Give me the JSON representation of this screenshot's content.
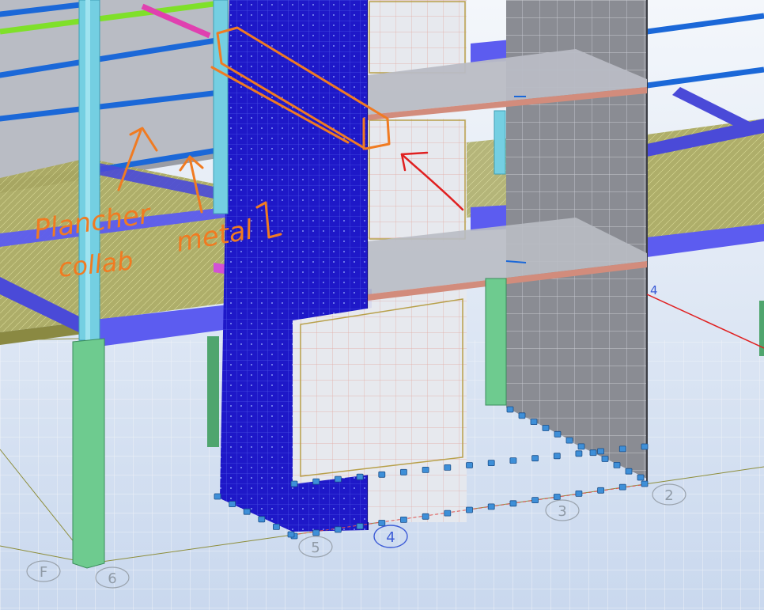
{
  "colors": {
    "background_top": "#f4f7fb",
    "background_bottom": "#c9d8ee",
    "blue_wall": "#1e18c8",
    "gray_wall": "#8a8c93",
    "slab_gray": "#b9bcc4",
    "beam_purple": "#5c5cf0",
    "column_cyan": "#74cfe2",
    "column_green": "#6ecb8f",
    "annotation_orange": "#f07b22",
    "annotation_red": "#e02020",
    "grid_label": "#8f9aa6",
    "grid_label_selected": "#3c5bd6"
  },
  "annotations": {
    "handwritten_line1": "Plancher",
    "handwritten_line2": "collab",
    "handwritten_metal": "metal"
  },
  "grid_labels": [
    {
      "id": "2",
      "text": "2",
      "selected": false
    },
    {
      "id": "3",
      "text": "3",
      "selected": false
    },
    {
      "id": "4",
      "text": "4",
      "selected": true
    },
    {
      "id": "5",
      "text": "5",
      "selected": false
    },
    {
      "id": "6",
      "text": "6",
      "selected": false
    },
    {
      "id": "F",
      "text": "F",
      "selected": false
    }
  ],
  "axis_marker": {
    "text": "4"
  }
}
